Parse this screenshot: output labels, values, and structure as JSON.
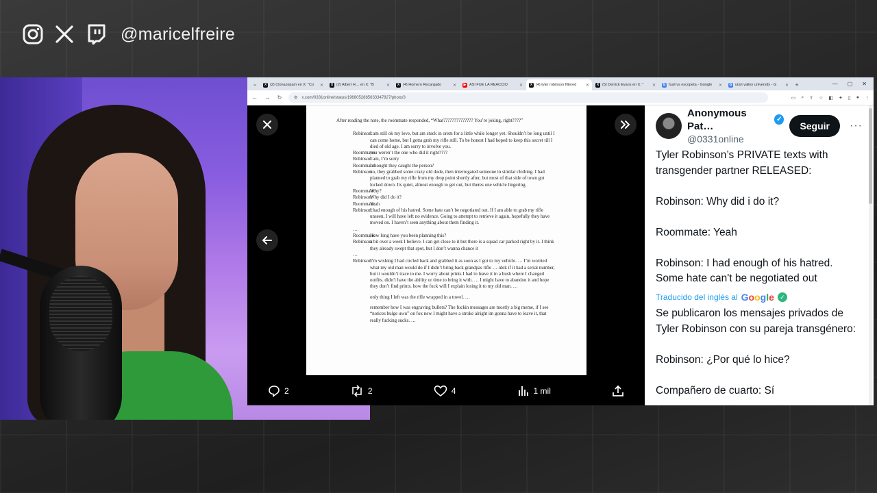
{
  "overlay": {
    "handle": "@maricelfreire",
    "icons": [
      "instagram-icon",
      "x-icon",
      "twitch-icon"
    ]
  },
  "browser": {
    "tabs": [
      {
        "title": "(2) Clonazepam en X: \"Co",
        "fav": "X",
        "color": "#111111"
      },
      {
        "title": "(2) Albert H… en X: \"B",
        "fav": "X",
        "color": "#111111"
      },
      {
        "title": "(4) Homero Recargado",
        "fav": "X",
        "color": "#111111"
      },
      {
        "title": "ASÍ FUE LA REACCIÓ",
        "fav": "▶",
        "color": "#ff0000"
      },
      {
        "title": "(4) tyler robinson filtered",
        "fav": "X",
        "color": "#111111"
      },
      {
        "title": "(5) Derrick Evans en X: \"",
        "fav": "X",
        "color": "#111111"
      },
      {
        "title": "fusil vs escopeta - Google",
        "fav": "G",
        "color": "#4285f4"
      },
      {
        "title": "utah valley university - G",
        "fav": "G",
        "color": "#4285f4"
      }
    ],
    "active_tab_index": 4,
    "url": "x.com/0331online/status/1968052885633347827/photo/3"
  },
  "document": {
    "intro": "After reading the note, the roommate responded, “What?????????????? You’re joking, right????”",
    "lines": [
      {
        "speaker": "Robinson:",
        "text": "I am still ok my love, but am stuck in orem for a little while longer yet. Shouldn’t be long until I can come home, but I gotta grab my rifle still. To be honest I had hoped to keep this secret till I died of old age. I am sorry to involve you."
      },
      {
        "speaker": "Roommate:",
        "text": "you weren’t the one who did it right????"
      },
      {
        "speaker": "Robinson:",
        "text": "I am, I’m sorry"
      },
      {
        "speaker": "Roommate:",
        "text": "I thought they caught the person?"
      },
      {
        "speaker": "Robinson:",
        "text": "no, they grabbed some crazy old dude, then interrogated someone in similar clothing. I had planned to grab my rifle from my drop point shortly after, but most of that side of town got locked down. Its quiet, almost enough to get out, but theres one vehicle lingering."
      },
      {
        "speaker": "Roommate:",
        "text": "Why?"
      },
      {
        "speaker": "Robinson:",
        "text": "Why did I do it?"
      },
      {
        "speaker": "Roommate:",
        "text": "Yeah"
      },
      {
        "speaker": "Robinson:",
        "text": "I had enough of his hatred. Some hate can’t be negotiated out. If I am able to grab my rifle unseen, I will have left no evidence. Going to attempt to retrieve it again, hopefully they have moved on. I haven’t seen anything about them finding it."
      },
      {
        "speaker": "…",
        "text": ""
      },
      {
        "speaker": "Roommate:",
        "text": "How long have you been planning this?"
      },
      {
        "speaker": "Robinson:",
        "text": "a bit over a week I believe. I can get close to it but there is a squad car parked right by it. I think they already swept that spot, but I don’t wanna chance it"
      },
      {
        "speaker": "…",
        "text": ""
      },
      {
        "speaker": "Robinson:",
        "text": "I’m wishing I had circled back and grabbed it as soon as I got to my vehicle. … I’m worried what my old man would do if I didn’t bring back grandpas rifle … idek if it had a serial number, but it wouldn’t trace to me. I worry about prints I had to leave it in a bush where I changed outfits. didn’t have the ability or time to bring it with. … I might have to abandon it and hope they don’t find prints. how the fuck will I explain losing it to my old man. …"
      },
      {
        "speaker": "",
        "text": "only thing I left was the rifle wrapped in a towel. …"
      },
      {
        "speaker": "",
        "text": "remember how I was engraving bullets? The fuckin messages are mostly a big meme, if I see “notices bulge uwu” on fox new I might have a stroke alright im gonna have to leave it, that really fucking sucks. …"
      }
    ]
  },
  "actions": {
    "replies": "2",
    "reposts": "2",
    "likes": "4",
    "views": "1 mil"
  },
  "tweet": {
    "display_name": "Anonymous Pat…",
    "username": "@0331online",
    "follow_label": "Seguir",
    "paragraphs": [
      "Tyler Robinson’s PRIVATE texts with transgender partner RELEASED:",
      "Robinson: Why did i do it?",
      "Roommate: Yeah",
      "Robinson: I had enough of his hatred. Some hate can't be negotiated out"
    ],
    "translated_label": "Traducido del inglés al",
    "translated_brand": "Google",
    "translated_paragraphs": [
      "Se publicaron los mensajes privados de Tyler Robinson con su pareja transgénero:",
      "Robinson: ¿Por qué lo hice?",
      "Compañero de cuarto: Sí"
    ]
  }
}
